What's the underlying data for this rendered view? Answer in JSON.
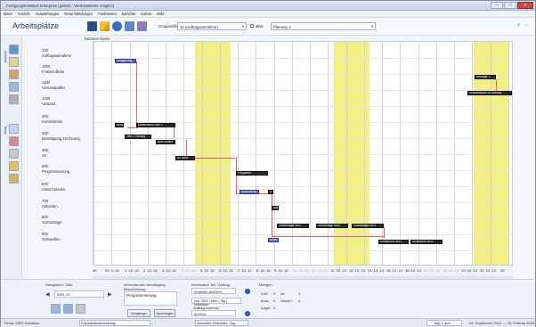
{
  "window": {
    "title": "Fertigungsleitstand Enterprise (gelöst) - Werkstattleiter möglich)"
  },
  "menu": [
    "Datei",
    "Ansicht",
    "Auswertungen",
    "Neue Meldungen",
    "Funktionen",
    "Berichte",
    "Extras",
    "Hilfe"
  ],
  "toolbar": {
    "title": "Arbeitsplätze",
    "group_filter_label": "Gruppenfilter",
    "group_filter_value": "10 (Auftragsannahme)",
    "aktiv_label": "aktiv",
    "planung_value": "Planung 1"
  },
  "sidebar": {
    "tab1": "Ansicht",
    "tab2": "Tools"
  },
  "rows_header": "Nummer Name",
  "rows": [
    {
      "num": "100",
      "name": "Auftragsannahme"
    },
    {
      "num": "1000",
      "name": "Freiberufliche"
    },
    {
      "num": "1100",
      "name": "Versandpuffer"
    },
    {
      "num": "1200",
      "name": "Versand"
    },
    {
      "num": "200",
      "name": "Konstruktion"
    },
    {
      "num": "300",
      "name": "Bestätigung Zeichnung"
    },
    {
      "num": "400",
      "name": "AV"
    },
    {
      "num": "500",
      "name": "Programmierung"
    },
    {
      "num": "600",
      "name": "Ausschneiden"
    },
    {
      "num": "700",
      "name": "Abkanten"
    },
    {
      "num": "800",
      "name": "Vormontage"
    },
    {
      "num": "900",
      "name": "Schweißen"
    }
  ],
  "bars": [
    {
      "label": "Verlagerung",
      "row": 0
    },
    {
      "label": "Montage 1",
      "row": 1
    },
    {
      "label": "Versandpuffer 99 Montag",
      "row": 2
    },
    {
      "label": "Kons",
      "row": 5
    },
    {
      "label": "Konstruktion Test 1",
      "row": 5
    },
    {
      "label": "Test 1 Planung",
      "row": 5
    },
    {
      "label": "Best.Muster",
      "row": 6
    },
    {
      "label": "AV 4994",
      "row": 7
    },
    {
      "label": "Programm",
      "row": 8
    },
    {
      "label": "Ausschneid",
      "row": 9
    },
    {
      "label": "A",
      "row": 10
    },
    {
      "label": "Abk",
      "row": 11
    },
    {
      "label": "Vormontage 9901",
      "row": 12
    },
    {
      "label": "Vormontage 9902",
      "row": 12
    },
    {
      "label": "Vormontage 9903",
      "row": 12
    },
    {
      "label": "Schw",
      "row": 13
    },
    {
      "label": "Schweißen 9901",
      "row": 13
    },
    {
      "label": "Schweißen 9902",
      "row": 13
    }
  ],
  "timeline": {
    "ticks": [
      "29",
      "30. 9. 14",
      "1. 10. 14",
      "2. 10. 14",
      "3. 10. 14",
      "4. 10. 14",
      "5. 10. 14",
      "6. 10. 14",
      "7. 10. 14",
      "8. 10. 14",
      "9. 10. 14",
      "10. 10. 14",
      "11. 10. 14",
      "12. 10. 14",
      "13. 10. 14",
      "14. 10. 14",
      "15. 10. 14",
      "16. 10. 14",
      "17. 10. 14",
      "18. 10. 14",
      "19. 10. 14",
      "20. 10. 14",
      "25"
    ]
  },
  "bottom": {
    "navigation_label": "Navigation / Task",
    "nav_value": "9901 10",
    "info_activity_label": "Informationen Arbeitsgang",
    "description_label": "Beschreibung",
    "description_value": "Programmierung",
    "btn_vorgaenger": "Vorgänger",
    "btn_nachfolger": "Nachfolger",
    "info_teil_label": "Information Teil / Auftrag",
    "teil_value": "0000000-00000%",
    "meta_line": "Kdn: 9901 | Mkrh | Tag | Unterstufe",
    "auftrag_label": "Auftrag Nummer",
    "auftrag_value": "007519",
    "mengen_label": "Mengen",
    "soll_label": "Soll:",
    "soll_value": "3",
    "ist_label": "Ist:",
    "ist_value": "3",
    "ausr_label": "Ausr.:",
    "ausr_value": "0",
    "gesch_label": "Gesch.:",
    "gesch_value": "0",
    "lager_label": "Lager:",
    "lager_value": "0"
  },
  "status": {
    "firma": "Firma:  ORG Solutions",
    "kapazitaet": "Kapazitätsdarstellung:",
    "aktuelles": "Aktuelles Zeitraster: Tag",
    "tage": "Tag/ 1 apo",
    "range": "29. September 2014 — 26. Februar 2015"
  },
  "colors": {
    "weekend": "#f2ef86",
    "bar": "#2a2a2a",
    "bar_selected": "#5d5fb0",
    "connector": "#e06060",
    "title": "#1f3b62"
  }
}
